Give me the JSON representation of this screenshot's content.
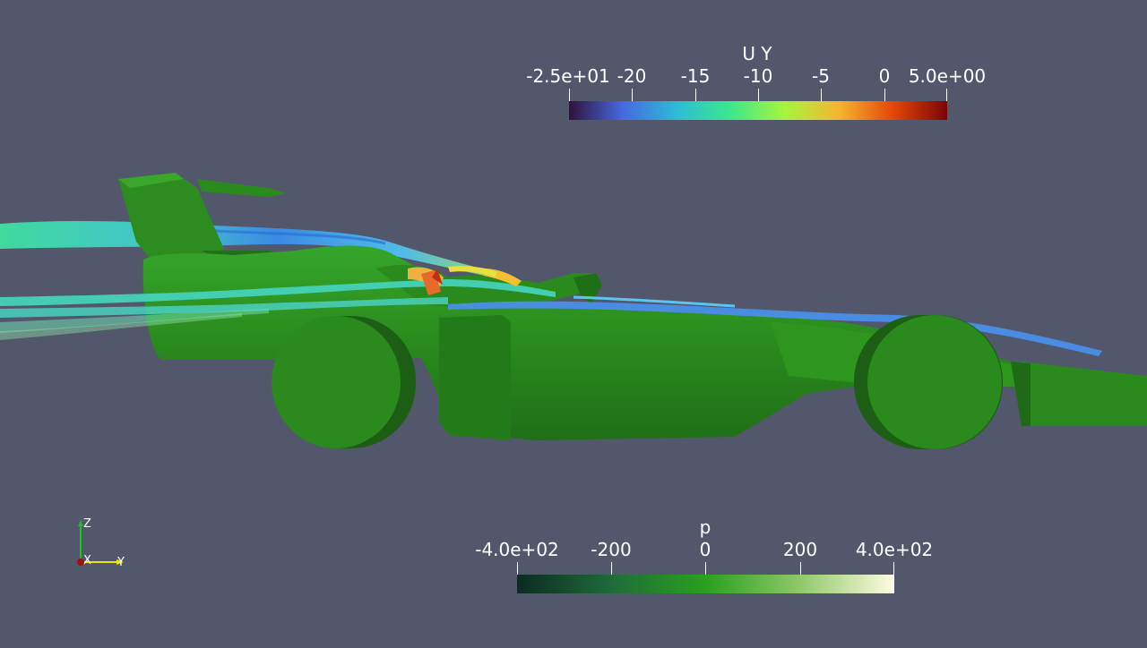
{
  "colorbars": {
    "velocity": {
      "title": "U Y",
      "ticks": [
        "-2.5e+01",
        "-20",
        "-15",
        "-10",
        "-5",
        "0",
        "5.0e+00"
      ],
      "gradient": [
        "#30123b",
        "#4669e0",
        "#2ebcd6",
        "#3de88c",
        "#a7f53e",
        "#f5b531",
        "#e4460a",
        "#7a0403"
      ]
    },
    "pressure": {
      "title": "p",
      "ticks": [
        "-4.0e+02",
        "-200",
        "0",
        "200",
        "4.0e+02"
      ],
      "gradient": [
        "#0c2a22",
        "#1f6b3a",
        "#2aa01e",
        "#90c86a",
        "#fffbe2"
      ]
    }
  },
  "orientation_axes": {
    "z_label": "Z",
    "x_label": "X",
    "y_label": "Y",
    "colors": {
      "z": "#20c020",
      "x": "#a01010",
      "y": "#e8e800"
    }
  },
  "scene": {
    "background": "#52576b",
    "car_color": "#2a8a1d"
  }
}
